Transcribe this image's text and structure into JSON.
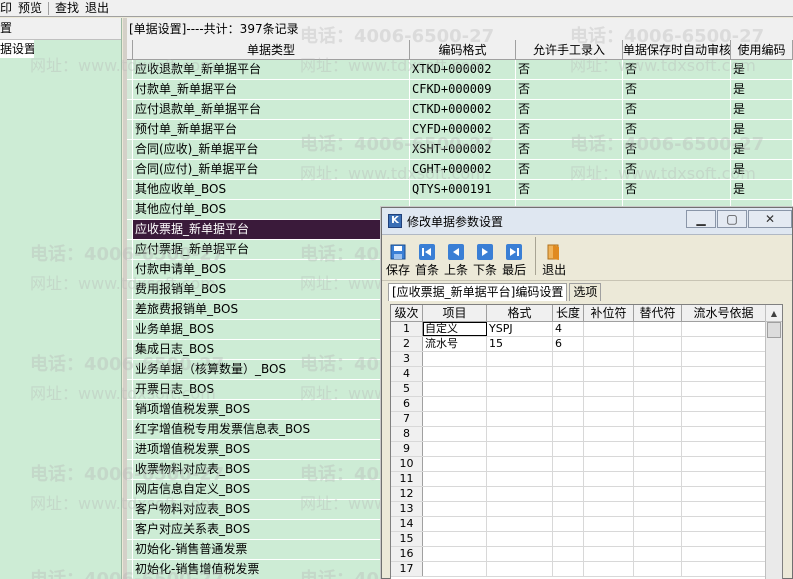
{
  "menubar": {
    "items": [
      "印",
      "预览",
      "查找",
      "退出"
    ]
  },
  "left_pane": {
    "header": "置",
    "selected_item": "据设置"
  },
  "main": {
    "caption": "[单据设置]----共计：397条记录",
    "columns": [
      "单据类型",
      "编码格式",
      "允许手工录入",
      "单据保存时自动审核",
      "使用编码"
    ],
    "rows": [
      {
        "type": "应收退款单_新单据平台",
        "code": "XTKD+000002",
        "manual": "否",
        "auto_audit": "否",
        "use": "是"
      },
      {
        "type": "付款单_新单据平台",
        "code": "CFKD+000009",
        "manual": "否",
        "auto_audit": "否",
        "use": "是"
      },
      {
        "type": "应付退款单_新单据平台",
        "code": "CTKD+000002",
        "manual": "否",
        "auto_audit": "否",
        "use": "是"
      },
      {
        "type": "预付单_新单据平台",
        "code": "CYFD+000002",
        "manual": "否",
        "auto_audit": "否",
        "use": "是"
      },
      {
        "type": "合同(应收)_新单据平台",
        "code": "XSHT+000002",
        "manual": "否",
        "auto_audit": "否",
        "use": "是"
      },
      {
        "type": "合同(应付)_新单据平台",
        "code": "CGHT+000002",
        "manual": "否",
        "auto_audit": "否",
        "use": "是"
      },
      {
        "type": "其他应收单_BOS",
        "code": "QTYS+000191",
        "manual": "否",
        "auto_audit": "否",
        "use": "是"
      },
      {
        "type": "其他应付单_BOS",
        "code": "",
        "manual": "",
        "auto_audit": "",
        "use": ""
      },
      {
        "type": "应收票据_新单据平台",
        "code": "",
        "manual": "",
        "auto_audit": "",
        "use": ""
      },
      {
        "type": "应付票据_新单据平台",
        "code": "",
        "manual": "",
        "auto_audit": "",
        "use": ""
      },
      {
        "type": "付款申请单_BOS",
        "code": "",
        "manual": "",
        "auto_audit": "",
        "use": ""
      },
      {
        "type": "费用报销单_BOS",
        "code": "",
        "manual": "",
        "auto_audit": "",
        "use": ""
      },
      {
        "type": "差旅费报销单_BOS",
        "code": "",
        "manual": "",
        "auto_audit": "",
        "use": ""
      },
      {
        "type": "业务单据_BOS",
        "code": "",
        "manual": "",
        "auto_audit": "",
        "use": ""
      },
      {
        "type": "集成日志_BOS",
        "code": "",
        "manual": "",
        "auto_audit": "",
        "use": ""
      },
      {
        "type": "业务单据（核算数量）_BOS",
        "code": "",
        "manual": "",
        "auto_audit": "",
        "use": ""
      },
      {
        "type": "开票日志_BOS",
        "code": "",
        "manual": "",
        "auto_audit": "",
        "use": ""
      },
      {
        "type": "销项增值税发票_BOS",
        "code": "",
        "manual": "",
        "auto_audit": "",
        "use": ""
      },
      {
        "type": "红字增值税专用发票信息表_BOS",
        "code": "",
        "manual": "",
        "auto_audit": "",
        "use": ""
      },
      {
        "type": "进项增值税发票_BOS",
        "code": "",
        "manual": "",
        "auto_audit": "",
        "use": ""
      },
      {
        "type": "收票物料对应表_BOS",
        "code": "",
        "manual": "",
        "auto_audit": "",
        "use": ""
      },
      {
        "type": "网店信息自定义_BOS",
        "code": "",
        "manual": "",
        "auto_audit": "",
        "use": ""
      },
      {
        "type": "客户物料对应表_BOS",
        "code": "",
        "manual": "",
        "auto_audit": "",
        "use": ""
      },
      {
        "type": "客户对应关系表_BOS",
        "code": "",
        "manual": "",
        "auto_audit": "",
        "use": ""
      },
      {
        "type": "初始化-销售普通发票",
        "code": "",
        "manual": "",
        "auto_audit": "",
        "use": ""
      },
      {
        "type": "初始化-销售增值税发票",
        "code": "",
        "manual": "",
        "auto_audit": "",
        "use": ""
      }
    ],
    "selected_row": 8
  },
  "watermark": {
    "phone": "电话：4006-6500-27",
    "site": "网址：www.tdxsoft.com"
  },
  "dialog": {
    "title": "修改单据参数设置",
    "window_buttons": [
      "▁",
      "▢",
      "✕"
    ],
    "toolbar": [
      {
        "label": "保存",
        "icon": "save-icon"
      },
      {
        "label": "首条",
        "icon": "first-record-icon"
      },
      {
        "label": "上条",
        "icon": "previous-record-icon"
      },
      {
        "label": "下条",
        "icon": "next-record-icon"
      },
      {
        "label": "最后",
        "icon": "last-record-icon"
      },
      {
        "label": "退出",
        "icon": "exit-icon"
      }
    ],
    "tabs": [
      "[应收票据_新单据平台]编码设置",
      "选项"
    ],
    "grid_columns": [
      "级次",
      "项目",
      "格式",
      "长度",
      "补位符",
      "替代符",
      "流水号依据"
    ],
    "grid_rows": [
      {
        "num": "1",
        "item": "自定义",
        "format": "YSPJ",
        "length": "4",
        "fill": "",
        "replace": "",
        "seq": ""
      },
      {
        "num": "2",
        "item": "流水号",
        "format": "15",
        "length": "6",
        "fill": "",
        "replace": "",
        "seq": ""
      },
      {
        "num": "3",
        "item": "",
        "format": "",
        "length": "",
        "fill": "",
        "replace": "",
        "seq": ""
      },
      {
        "num": "4",
        "item": "",
        "format": "",
        "length": "",
        "fill": "",
        "replace": "",
        "seq": ""
      },
      {
        "num": "5",
        "item": "",
        "format": "",
        "length": "",
        "fill": "",
        "replace": "",
        "seq": ""
      },
      {
        "num": "6",
        "item": "",
        "format": "",
        "length": "",
        "fill": "",
        "replace": "",
        "seq": ""
      },
      {
        "num": "7",
        "item": "",
        "format": "",
        "length": "",
        "fill": "",
        "replace": "",
        "seq": ""
      },
      {
        "num": "8",
        "item": "",
        "format": "",
        "length": "",
        "fill": "",
        "replace": "",
        "seq": ""
      },
      {
        "num": "9",
        "item": "",
        "format": "",
        "length": "",
        "fill": "",
        "replace": "",
        "seq": ""
      },
      {
        "num": "10",
        "item": "",
        "format": "",
        "length": "",
        "fill": "",
        "replace": "",
        "seq": ""
      },
      {
        "num": "11",
        "item": "",
        "format": "",
        "length": "",
        "fill": "",
        "replace": "",
        "seq": ""
      },
      {
        "num": "12",
        "item": "",
        "format": "",
        "length": "",
        "fill": "",
        "replace": "",
        "seq": ""
      },
      {
        "num": "13",
        "item": "",
        "format": "",
        "length": "",
        "fill": "",
        "replace": "",
        "seq": ""
      },
      {
        "num": "14",
        "item": "",
        "format": "",
        "length": "",
        "fill": "",
        "replace": "",
        "seq": ""
      },
      {
        "num": "15",
        "item": "",
        "format": "",
        "length": "",
        "fill": "",
        "replace": "",
        "seq": ""
      },
      {
        "num": "16",
        "item": "",
        "format": "",
        "length": "",
        "fill": "",
        "replace": "",
        "seq": ""
      },
      {
        "num": "17",
        "item": "",
        "format": "",
        "length": "",
        "fill": "",
        "replace": "",
        "seq": ""
      }
    ]
  },
  "colors": {
    "grid_bg": "#cdecd5",
    "selected_row": "#3a1a3a",
    "dialog_bg": "#ece9d8",
    "toolbar_icon": "#3a7fd5",
    "exit_icon": "#e08a20"
  }
}
